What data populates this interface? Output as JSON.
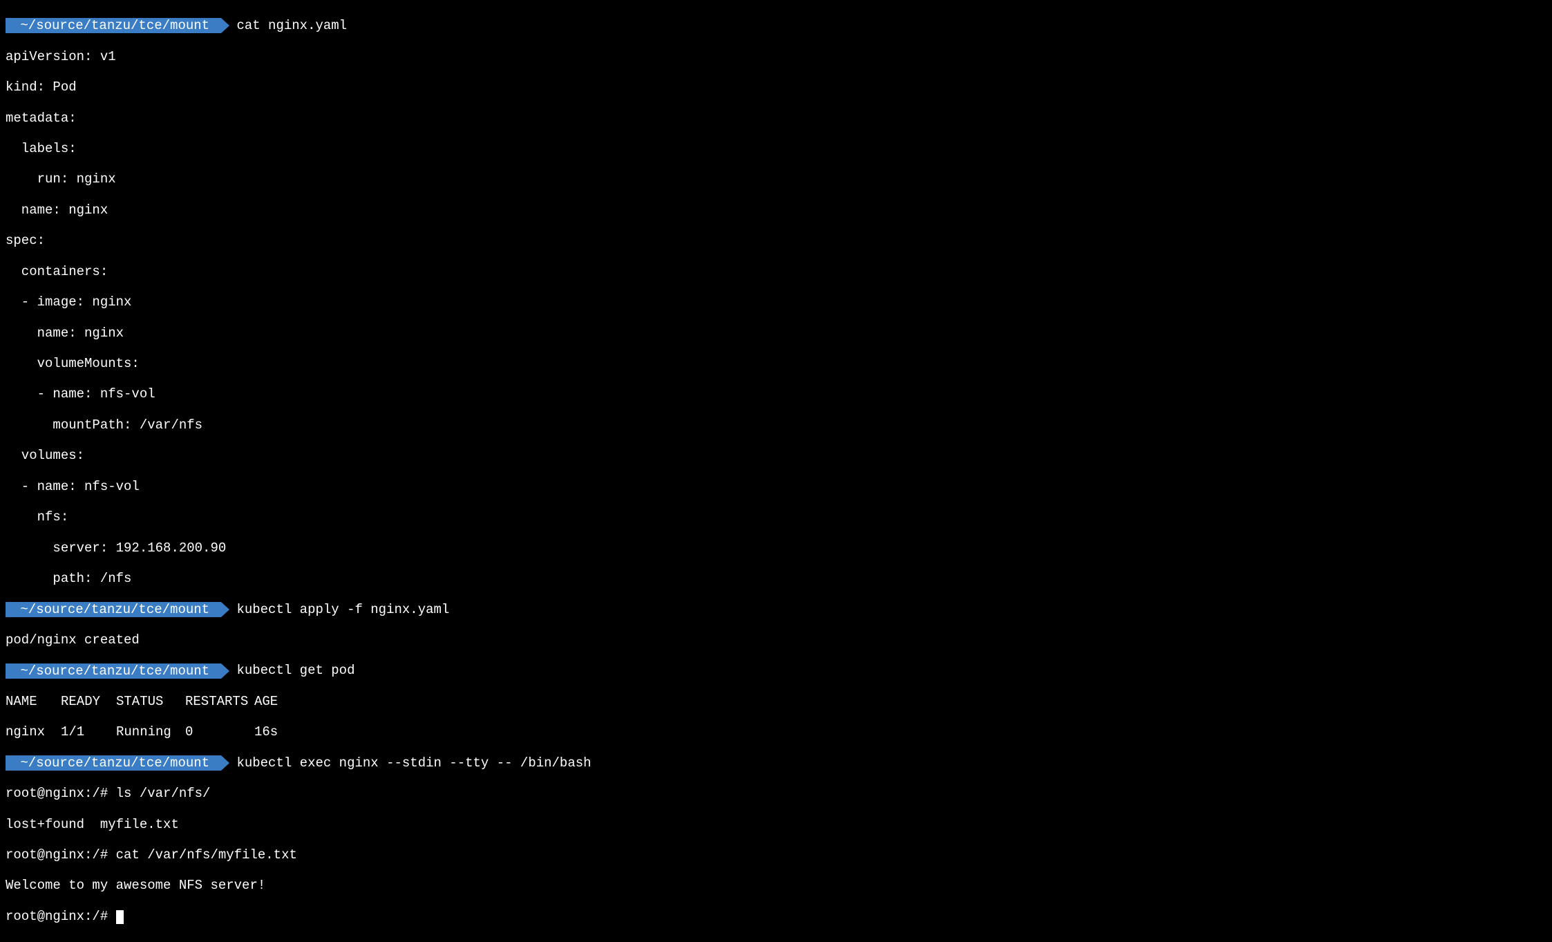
{
  "prompt_path": " ~/source/tanzu/tce/mount ",
  "commands": {
    "cmd1": "cat nginx.yaml",
    "cmd2": "kubectl apply -f nginx.yaml",
    "cmd3": "kubectl get pod",
    "cmd4": "kubectl exec nginx --stdin --tty -- /bin/bash"
  },
  "yaml_output": {
    "l1": "apiVersion: v1",
    "l2": "kind: Pod",
    "l3": "metadata:",
    "l4": "  labels:",
    "l5": "    run: nginx",
    "l6": "  name: nginx",
    "l7": "spec:",
    "l8": "  containers:",
    "l9": "  - image: nginx",
    "l10": "    name: nginx",
    "l11": "    volumeMounts:",
    "l12": "    - name: nfs-vol",
    "l13": "      mountPath: /var/nfs",
    "l14": "  volumes:",
    "l15": "  - name: nfs-vol",
    "l16": "    nfs:",
    "l17": "      server: 192.168.200.90",
    "l18": "      path: /nfs"
  },
  "apply_output": "pod/nginx created",
  "pod_table": {
    "headers": {
      "name": "NAME",
      "ready": "READY",
      "status": "STATUS",
      "restarts": "RESTARTS",
      "age": "AGE"
    },
    "row": {
      "name": "nginx",
      "ready": "1/1",
      "status": "Running",
      "restarts": "0",
      "age": "16s"
    }
  },
  "shell": {
    "prompt1": "root@nginx:/# ",
    "cmd1": "ls /var/nfs/",
    "out1": "lost+found  myfile.txt",
    "prompt2": "root@nginx:/# ",
    "cmd2": "cat /var/nfs/myfile.txt",
    "out2": "Welcome to my awesome NFS server!",
    "prompt3": "root@nginx:/# "
  }
}
